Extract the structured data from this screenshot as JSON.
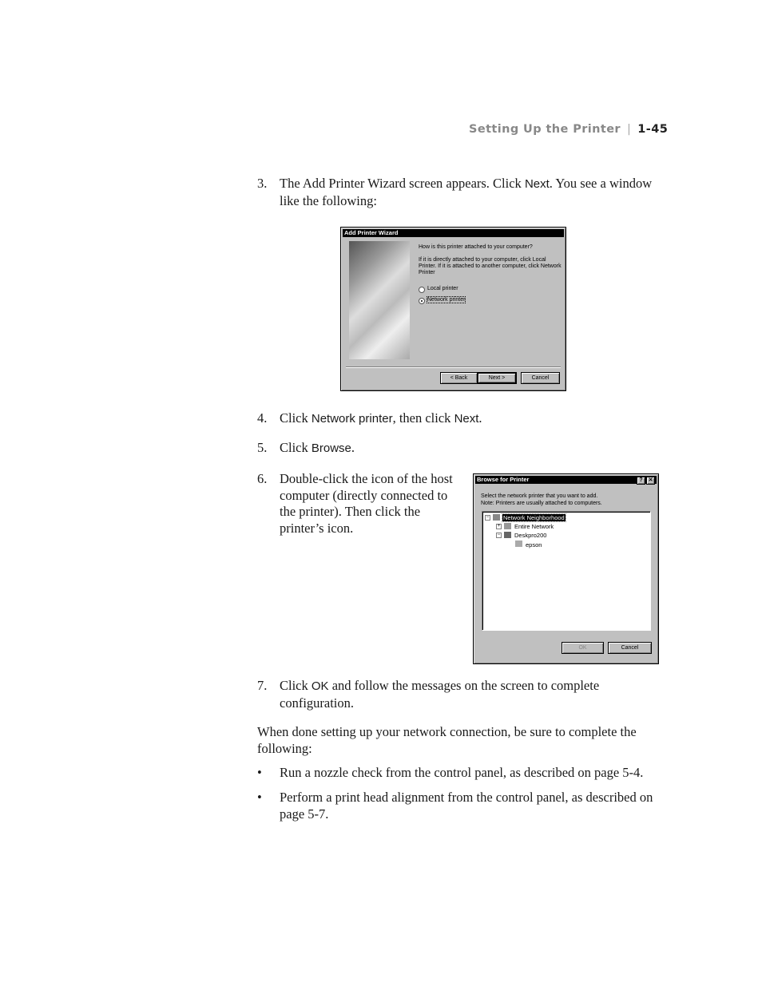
{
  "header": {
    "section": "Setting Up the Printer",
    "separator": "|",
    "page": "1-45"
  },
  "steps": [
    {
      "num": "3.",
      "pre": "The Add Printer Wizard screen appears. Click ",
      "ui": "Next",
      "post": ". You see a window like the following:"
    },
    {
      "num": "4.",
      "pre": "Click ",
      "ui": "Network printer",
      "mid": ", then click ",
      "ui2": "Next",
      "post": "."
    },
    {
      "num": "5.",
      "pre": "Click ",
      "ui": "Browse",
      "post": "."
    },
    {
      "num": "6.",
      "text": "Double-click the icon of the host computer (directly connected to the printer). Then click the printer’s icon."
    },
    {
      "num": "7.",
      "pre": "Click ",
      "ui": "OK",
      "post": " and follow the messages on the screen to complete configuration."
    }
  ],
  "closing": "When done setting up your network connection, be sure to complete the following:",
  "bullets": [
    "Run a nozzle check from the control panel, as described on page 5-4.",
    "Perform a print head alignment from the control panel, as described on page 5-7."
  ],
  "bullet_glyph": "•",
  "wizard": {
    "title": "Add Printer Wizard",
    "question": "How is this printer attached to your computer?",
    "instructions": "If it is directly attached to your computer, click Local Printer. If it is attached to another computer, click Network Printer",
    "options": [
      {
        "label": "Local printer",
        "selected": false
      },
      {
        "label": "Network printer",
        "selected": true
      }
    ],
    "back": "< Back",
    "next": "Next >",
    "cancel": "Cancel"
  },
  "browse": {
    "title": "Browse for Printer",
    "help": "?",
    "close": "✕",
    "line1": "Select the network printer that you want to add.",
    "line2": "Note: Printers are usually attached to computers.",
    "tree": [
      {
        "label": "Network Neighborhood",
        "expander": "−"
      },
      {
        "label": "Entire Network",
        "expander": "+"
      },
      {
        "label": "Deskpro200",
        "expander": "−"
      },
      {
        "label": "epson",
        "expander": ""
      }
    ],
    "ok": "OK",
    "cancel": "Cancel"
  }
}
